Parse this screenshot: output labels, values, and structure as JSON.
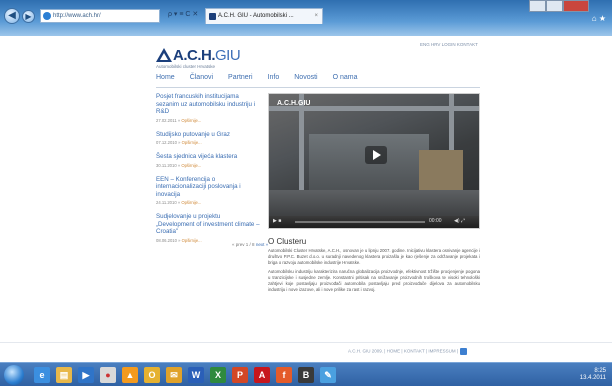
{
  "browser": {
    "address": "http://www.ach.hr/",
    "tab_title": "A.C.H. GIU - Automobilski ..."
  },
  "site": {
    "logo_main": "A.C.H.",
    "logo_suffix": "GIU",
    "tagline": "Automobilski cluster Hrvatske",
    "toplinks": "ENG  HRV  LOGIN  KONTAKT"
  },
  "menu": [
    "Home",
    "Članovi",
    "Partneri",
    "Info",
    "Novosti",
    "O nama"
  ],
  "news": [
    {
      "title": "Posjet francuskih institucijama sezanim uz automobilsku industriju i R&D",
      "date": "27.02.2011",
      "more": "Opširnije..."
    },
    {
      "title": "Studijsko putovanje u Graz",
      "date": "07.12.2010",
      "more": "Opširnije..."
    },
    {
      "title": "Šesta sjednica vijeća klastera",
      "date": "30.11.2010",
      "more": "Opširnije..."
    },
    {
      "title": "EEN – Konferencija o internacionalizaciji poslovanja i inovacija",
      "date": "24.11.2010",
      "more": "Opširnije..."
    },
    {
      "title": "Sudjelovanje u projektu „Development of investment climate – Croatia\"",
      "date": "08.06.2010",
      "more": "Opširnije..."
    }
  ],
  "pager": {
    "prev": "« prev",
    "page": "1 / 8",
    "next": "next »"
  },
  "video": {
    "overlay_logo": "A.C.H.GIU",
    "time": "00:00"
  },
  "about": {
    "title": "O Clusteru",
    "p1": "Automobilski Cluster Hrvatske, A.C.H., osnovan je u lipnju 2007. godine. Inicijativu klastera osnivanje agencije i društvo P.P.C. Buzet d.o.o. u suradnji navedenog klastera proizašla je kao rješenje za održavanje projekata i briga o razvoju automobilske industrije Hrvatske.",
    "p2": "Automobilsku industriju karakterizira naručna globalizacija proizvodnje, efektivnost tržište procjenjenje pogona u tranzicijske i susjedne zemlje. Konstantni pritisak na snižavanje proizvodnih troškova te visoki tehnološki zahtjevi koje postavljaju proizvođači automobila postavljaju pred proizvođače dijelova za automobilsku industriju i nove izazove, ali i nove prilike za rast i razvoj."
  },
  "footer": "A.C.H. GIU 2009. | HOME | KONTAKT | IMPRESSUM |",
  "taskbar": {
    "apps": [
      "ie",
      "explorer",
      "media",
      "chrome",
      "vlc",
      "outlook",
      "word",
      "excel",
      "powerpoint",
      "acrobat",
      "firefox",
      "bb",
      "paint"
    ],
    "tray_time": "8:25",
    "tray_date": "13.4.2011"
  },
  "colors": {
    "brand": "#1b3f7c",
    "link": "#3a6db2",
    "taskbar": "#2f61a3"
  }
}
